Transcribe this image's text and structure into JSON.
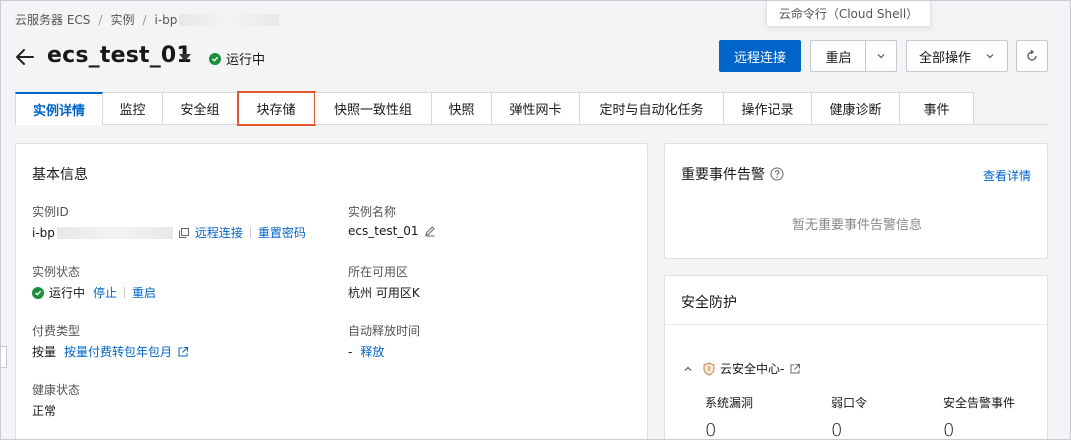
{
  "breadcrumb": {
    "items": [
      "云服务器 ECS",
      "实例",
      "i-bp"
    ],
    "separator": "/"
  },
  "tooltip": {
    "text": "云命令行（Cloud Shell）"
  },
  "header": {
    "title": "ecs_test_01",
    "status": "运行中"
  },
  "actions": {
    "remote_connect": "远程连接",
    "restart": "重启",
    "all_operations": "全部操作"
  },
  "tabs": [
    {
      "label": "实例详情",
      "active": true
    },
    {
      "label": "监控"
    },
    {
      "label": "安全组"
    },
    {
      "label": "块存储",
      "highlighted": true
    },
    {
      "label": "快照一致性组"
    },
    {
      "label": "快照"
    },
    {
      "label": "弹性网卡"
    },
    {
      "label": "定时与自动化任务"
    },
    {
      "label": "操作记录"
    },
    {
      "label": "健康诊断"
    },
    {
      "label": "事件"
    }
  ],
  "basic_info": {
    "title": "基本信息",
    "instance_id": {
      "label": "实例ID",
      "value": "i-bp",
      "link_remote": "远程连接",
      "link_reset": "重置密码"
    },
    "instance_name": {
      "label": "实例名称",
      "value": "ecs_test_01"
    },
    "instance_status": {
      "label": "实例状态",
      "value": "运行中",
      "link_stop": "停止",
      "link_restart": "重启"
    },
    "zone": {
      "label": "所在可用区",
      "value": "杭州 可用区K"
    },
    "billing": {
      "label": "付费类型",
      "value": "按量",
      "link_convert": "按量付费转包年包月"
    },
    "auto_release": {
      "label": "自动释放时间",
      "value": "-",
      "link_release": "释放"
    },
    "health": {
      "label": "健康状态",
      "value": "正常"
    }
  },
  "events": {
    "title": "重要事件告警",
    "view_details": "查看详情",
    "empty": "暂无重要事件告警信息"
  },
  "security": {
    "title": "安全防护",
    "center": "云安全中心-",
    "stats": [
      {
        "label": "系统漏洞",
        "value": "0"
      },
      {
        "label": "弱口令",
        "value": "0"
      },
      {
        "label": "安全告警事件",
        "value": "0"
      }
    ]
  },
  "colors": {
    "primary": "#0064c8",
    "success": "#1e8e3e",
    "highlight": "#e0582c"
  }
}
